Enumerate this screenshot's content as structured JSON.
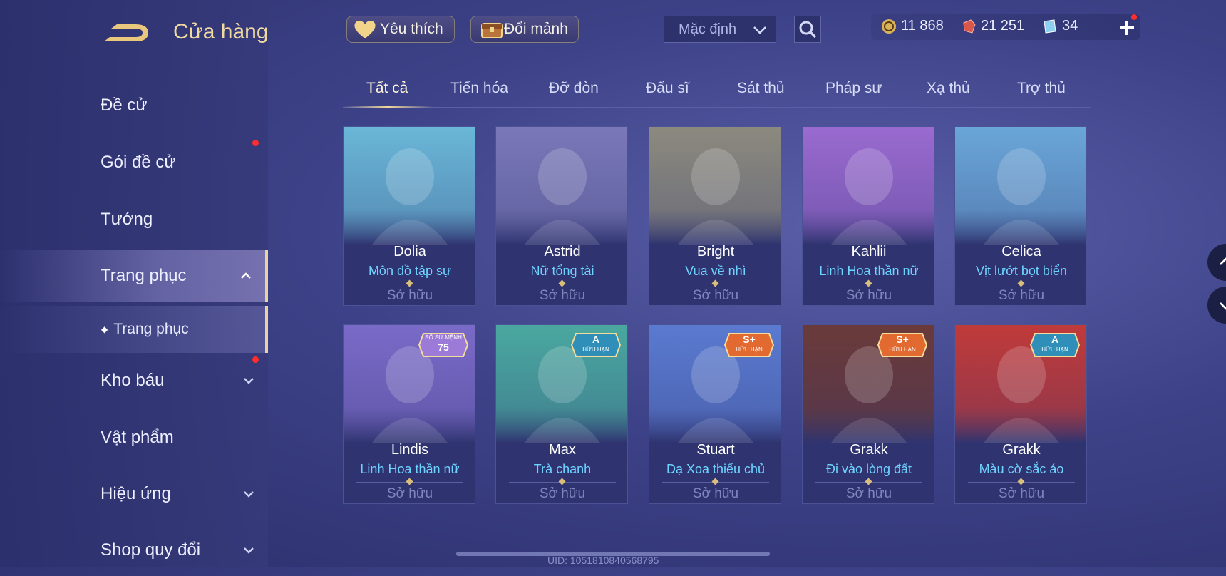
{
  "header": {
    "title": "Cửa hàng"
  },
  "nav": {
    "items": [
      {
        "label": "Đề cử"
      },
      {
        "label": "Gói đề cử"
      },
      {
        "label": "Tướng"
      },
      {
        "label": "Trang phục"
      },
      {
        "label": "Trang phục"
      },
      {
        "label": "Kho báu"
      },
      {
        "label": "Vật phẩm"
      },
      {
        "label": "Hiệu ứng"
      },
      {
        "label": "Shop quy đổi"
      }
    ]
  },
  "topbar": {
    "favorite_label": "Yêu thích",
    "exchange_label": "Đổi mảnh",
    "sort_value": "Mặc định"
  },
  "currency": {
    "gold": "11 868",
    "red_gems": "21 251",
    "vouchers": "34"
  },
  "tabs": [
    "Tất cả",
    "Tiến hóa",
    "Đỡ đòn",
    "Đấu sĩ",
    "Sát thủ",
    "Pháp sư",
    "Xạ thủ",
    "Trợ thủ"
  ],
  "cards": [
    {
      "hero": "Dolia",
      "skin": "Môn đồ tập sự",
      "status": "Sở hữu",
      "color": "#6ab7d8"
    },
    {
      "hero": "Astrid",
      "skin": "Nữ tổng tài",
      "status": "Sở hữu",
      "color": "#7a78b8"
    },
    {
      "hero": "Bright",
      "skin": "Vua về nhì",
      "status": "Sở hữu",
      "color": "#8c8a7e"
    },
    {
      "hero": "Kahlii",
      "skin": "Linh Hoa thần nữ",
      "status": "Sở hữu",
      "color": "#9a6ad0"
    },
    {
      "hero": "Celica",
      "skin": "Vịt lướt bọt biển",
      "status": "Sở hữu",
      "color": "#6aa6d8"
    },
    {
      "hero": "Lindis",
      "skin": "Linh Hoa thần nữ",
      "status": "Sở hữu",
      "color": "#7a6ac8",
      "badge_top": "SỔ SỨ MỆNH",
      "badge_main": "75"
    },
    {
      "hero": "Max",
      "skin": "Trà chanh",
      "status": "Sở hữu",
      "color": "#4aa8a0",
      "badge_main": "A",
      "badge_sub": "HỮU HẠN"
    },
    {
      "hero": "Stuart",
      "skin": "Dạ Xoa thiếu chủ",
      "status": "Sở hữu",
      "color": "#5a7ad0",
      "badge_main": "S+",
      "badge_sub": "HỮU HẠN"
    },
    {
      "hero": "Grakk",
      "skin": "Đi vào lòng đất",
      "status": "Sở hữu",
      "color": "#6a3a3a",
      "badge_main": "S+",
      "badge_sub": "HỮU HẠN"
    },
    {
      "hero": "Grakk",
      "skin": "Màu cờ sắc áo",
      "status": "Sở hữu",
      "color": "#c03a3a",
      "badge_main": "A",
      "badge_sub": "HỮU HẠN"
    }
  ],
  "footer": {
    "uid": "UID: 1051810840568795"
  }
}
